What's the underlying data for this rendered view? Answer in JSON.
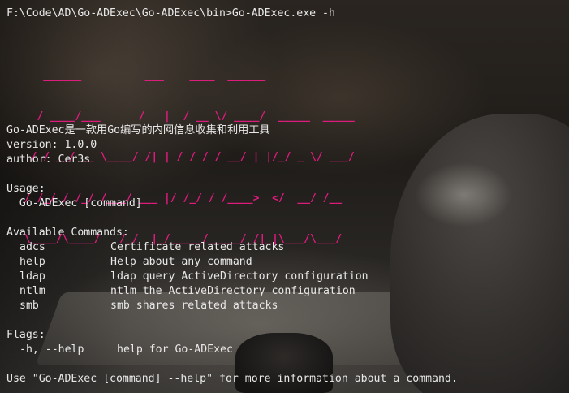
{
  "prompt_line": "F:\\Code\\AD\\Go-ADExec\\Go-ADExec\\bin>Go-ADExec.exe -h",
  "banner_ascii": [
    "    ______          ___    ____  ______",
    "   / ____/___      /   |  / __ \\/ ____/  _____  _____",
    "  / / __/ __ \\____/ /| | / / / / __/ | |/_/ _ \\/ ___/",
    " / /_/ / /_/ /___/ ___ |/ /_/ / /____>  </  __/ /__",
    " \\____/\\____/   /_/  |_/_____/_____/_/|_|\\___/\\___/"
  ],
  "description": "Go-ADExec是一款用Go编写的内网信息收集和利用工具",
  "version_line": "version: 1.0.0",
  "author_line": "author: Cer3s",
  "usage_header": "Usage:",
  "usage_line": "  Go-ADExec [command]",
  "commands_header": "Available Commands:",
  "commands": [
    {
      "name": "adcs",
      "desc": "Certificate related attacks"
    },
    {
      "name": "help",
      "desc": "Help about any command"
    },
    {
      "name": "ldap",
      "desc": "ldap query ActiveDirectory configuration"
    },
    {
      "name": "ntlm",
      "desc": "ntlm the ActiveDirectory configuration"
    },
    {
      "name": "smb",
      "desc": "smb shares related attacks"
    }
  ],
  "flags_header": "Flags:",
  "flags": [
    {
      "name": "-h, --help",
      "desc": "help for Go-ADExec"
    }
  ],
  "footer_line": "Use \"Go-ADExec [command] --help\" for more information about a command.",
  "colors": {
    "banner": "#e01b7e",
    "text": "#e8e8e8"
  }
}
